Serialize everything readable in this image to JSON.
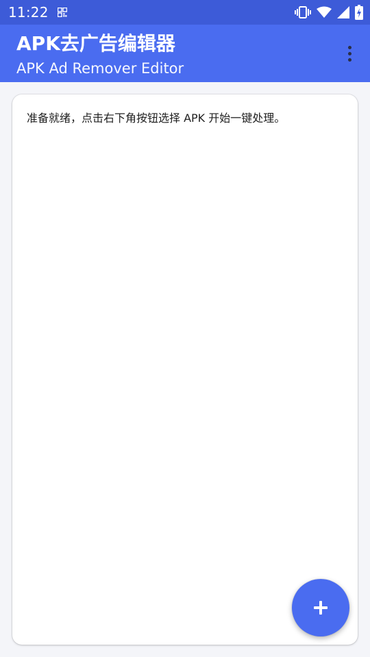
{
  "status_bar": {
    "time": "11:22",
    "icons": [
      "qr-code-icon",
      "vibrate-icon",
      "wifi-icon",
      "signal-icon",
      "battery-charging-icon"
    ]
  },
  "app_bar": {
    "title": "APK去广告编辑器",
    "subtitle": "APK Ad Remover Editor",
    "menu_icon": "more-vert-icon"
  },
  "content": {
    "log_text": "准备就绪，点击右下角按钮选择 APK 开始一键处理。"
  },
  "fab": {
    "icon": "add-icon"
  },
  "colors": {
    "status_bar": "#3D5BD8",
    "app_bar": "#4A6CF0",
    "fab": "#4A6CF0",
    "background": "#F4F5F9",
    "card": "#FFFFFF"
  }
}
